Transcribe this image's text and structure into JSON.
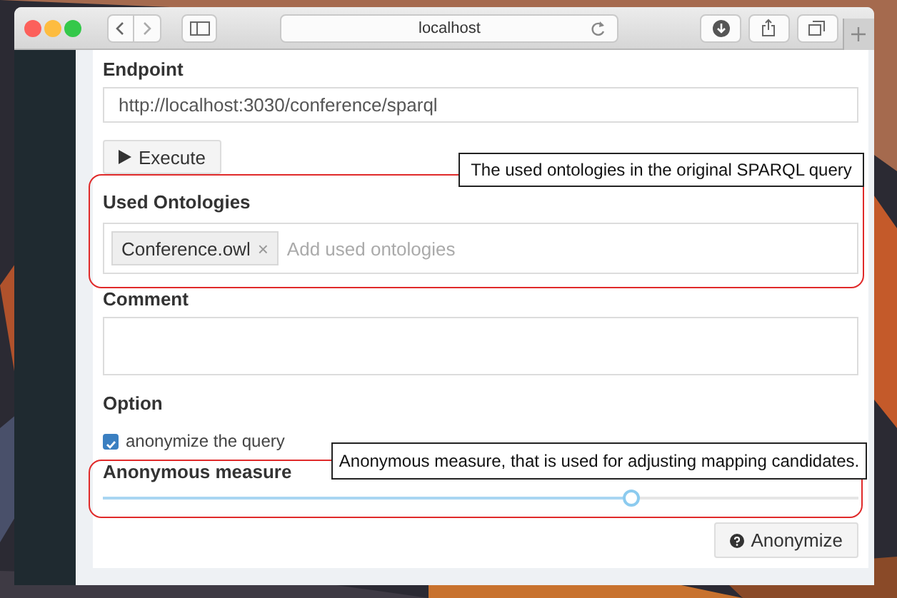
{
  "browser": {
    "address": "localhost"
  },
  "form": {
    "endpoint": {
      "label": "Endpoint",
      "value": "http://localhost:3030/conference/sparql"
    },
    "execute_button": {
      "label": "Execute"
    },
    "used_ontologies": {
      "label": "Used Ontologies",
      "tags": [
        {
          "label": "Conference.owl",
          "remove": "×"
        }
      ],
      "placeholder": "Add used ontologies"
    },
    "comment": {
      "label": "Comment"
    },
    "option": {
      "label": "Option"
    },
    "anonymize_checkbox": {
      "label": "anonymize the query",
      "checked": true
    },
    "measure": {
      "label": "Anonymous measure",
      "level": 0.7
    },
    "anonymize_button": {
      "label": "Anonymize"
    }
  },
  "annotations": [
    {
      "text": "The used ontologies in the original SPARQL query"
    },
    {
      "text": "Anonymous measure, that is used for adjusting mapping candidates."
    }
  ]
}
